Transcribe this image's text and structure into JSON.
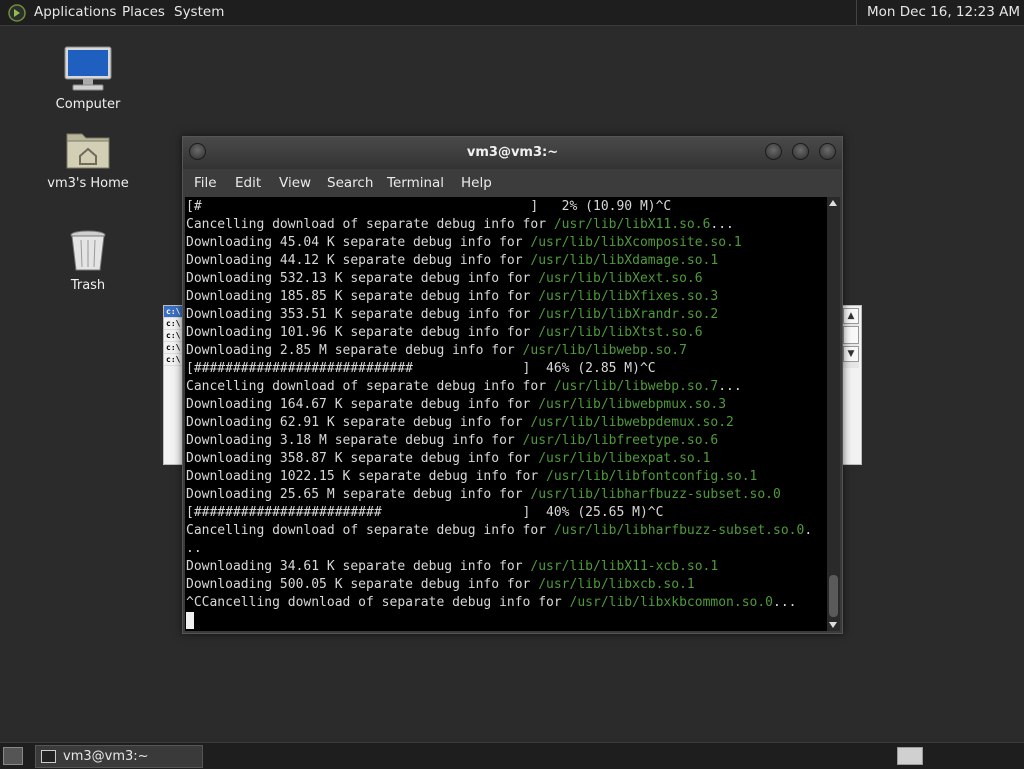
{
  "top_panel": {
    "menus": [
      "Applications",
      "Places",
      "System"
    ],
    "clock": "Mon Dec 16, 12:23 AM"
  },
  "desktop_icons": [
    {
      "label": "Computer",
      "icon": "computer-icon"
    },
    {
      "label": "vm3's Home",
      "icon": "home-folder-icon"
    },
    {
      "label": "Trash",
      "icon": "trash-icon"
    }
  ],
  "background_window": {
    "left_items": [
      "c:\\",
      "c:\\",
      "c:\\",
      "c:\\",
      "c:\\"
    ]
  },
  "terminal": {
    "title": "vm3@vm3:~",
    "menus": [
      "File",
      "Edit",
      "View",
      "Search",
      "Terminal",
      "Help"
    ],
    "lines": [
      {
        "text": "[#                                          ]   2% (10.90 M)^C",
        "path": ""
      },
      {
        "text": "Cancelling download of separate debug info for ",
        "path": "/usr/lib/libX11.so.6",
        "after": "..."
      },
      {
        "text": "Downloading 45.04 K separate debug info for ",
        "path": "/usr/lib/libXcomposite.so.1",
        "after": ""
      },
      {
        "text": "Downloading 44.12 K separate debug info for ",
        "path": "/usr/lib/libXdamage.so.1",
        "after": ""
      },
      {
        "text": "Downloading 532.13 K separate debug info for ",
        "path": "/usr/lib/libXext.so.6",
        "after": ""
      },
      {
        "text": "Downloading 185.85 K separate debug info for ",
        "path": "/usr/lib/libXfixes.so.3",
        "after": ""
      },
      {
        "text": "Downloading 353.51 K separate debug info for ",
        "path": "/usr/lib/libXrandr.so.2",
        "after": ""
      },
      {
        "text": "Downloading 101.96 K separate debug info for ",
        "path": "/usr/lib/libXtst.so.6",
        "after": ""
      },
      {
        "text": "Downloading 2.85 M separate debug info for ",
        "path": "/usr/lib/libwebp.so.7",
        "after": ""
      },
      {
        "text": "[############################              ]  46% (2.85 M)^C",
        "path": ""
      },
      {
        "text": "Cancelling download of separate debug info for ",
        "path": "/usr/lib/libwebp.so.7",
        "after": "..."
      },
      {
        "text": "Downloading 164.67 K separate debug info for ",
        "path": "/usr/lib/libwebpmux.so.3",
        "after": ""
      },
      {
        "text": "Downloading 62.91 K separate debug info for ",
        "path": "/usr/lib/libwebpdemux.so.2",
        "after": ""
      },
      {
        "text": "Downloading 3.18 M separate debug info for ",
        "path": "/usr/lib/libfreetype.so.6",
        "after": ""
      },
      {
        "text": "Downloading 358.87 K separate debug info for ",
        "path": "/usr/lib/libexpat.so.1",
        "after": ""
      },
      {
        "text": "Downloading 1022.15 K separate debug info for ",
        "path": "/usr/lib/libfontconfig.so.1",
        "after": ""
      },
      {
        "text": "Downloading 25.65 M separate debug info for ",
        "path": "/usr/lib/libharfbuzz-subset.so.0",
        "after": ""
      },
      {
        "text": "[########################                  ]  40% (25.65 M)^C",
        "path": ""
      },
      {
        "text": "Cancelling download of separate debug info for ",
        "path": "/usr/lib/libharfbuzz-subset.so.0",
        "after": "."
      },
      {
        "text": "..",
        "path": ""
      },
      {
        "text": "Downloading 34.61 K separate debug info for ",
        "path": "/usr/lib/libX11-xcb.so.1",
        "after": ""
      },
      {
        "text": "Downloading 500.05 K separate debug info for ",
        "path": "/usr/lib/libxcb.so.1",
        "after": ""
      },
      {
        "text": "^CCancelling download of separate debug info for ",
        "path": "/usr/lib/libxkbcommon.so.0",
        "after": "..."
      }
    ]
  },
  "taskbar": {
    "task_label": "vm3@vm3:~"
  },
  "colors": {
    "path_green": "#4f9a3a",
    "terminal_bg": "#000000",
    "panel_bg": "#1e1e1e"
  }
}
